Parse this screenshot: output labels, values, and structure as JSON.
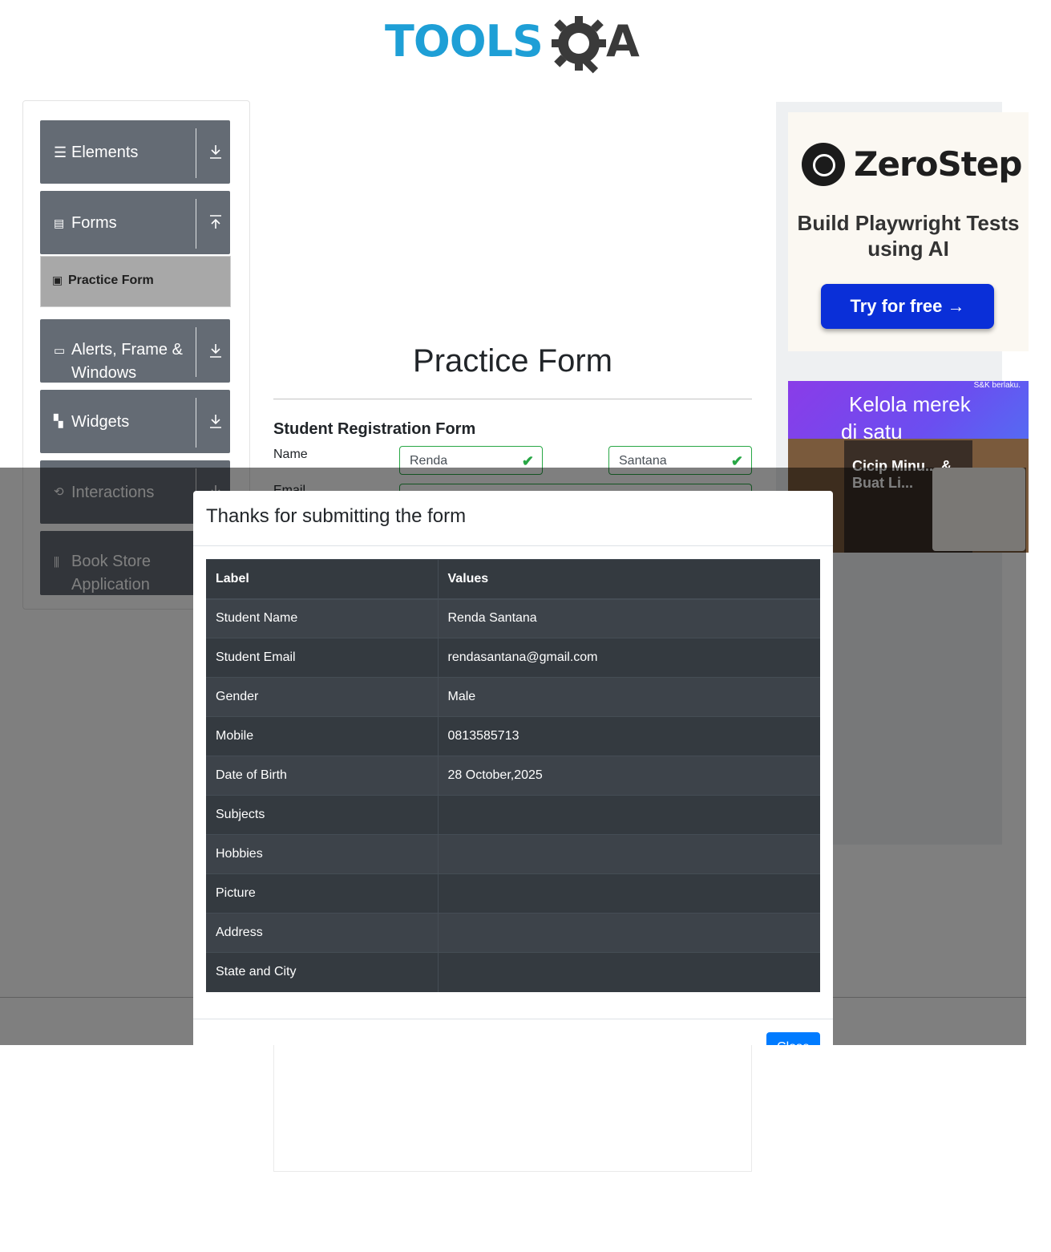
{
  "header": {
    "logo_word": "TOOLS",
    "logo_a": "A"
  },
  "sidebar": {
    "groups": [
      {
        "label": "Elements",
        "icon": "list-icon"
      },
      {
        "label": "Forms",
        "icon": "document-icon"
      },
      {
        "label": "Alerts, Frame & Windows",
        "icon": "window-icon"
      },
      {
        "label": "Widgets",
        "icon": "widgets-icon"
      },
      {
        "label": "Interactions",
        "icon": "interactions-icon"
      },
      {
        "label": "Book Store Application",
        "icon": "books-icon"
      }
    ],
    "active_item": "Practice Form"
  },
  "main": {
    "title": "Practice Form",
    "form_heading": "Student Registration Form",
    "name_label": "Name",
    "email_label": "Email",
    "first_name": "Renda",
    "last_name": "Santana"
  },
  "ads": {
    "zerostep_name": "ZeroStep",
    "zerostep_tagline": "Build Playwright Tests using AI",
    "zerostep_cta": "Try for free →",
    "banner_line1": "Kelola merek",
    "banner_line2": "di satu",
    "banner_note": "S&K berlaku.",
    "banner_card": "Cicip Minu... & Buat Li..."
  },
  "modal": {
    "title": "Thanks for submitting the form",
    "columns": [
      "Label",
      "Values"
    ],
    "rows": [
      [
        "Student Name",
        "Renda Santana"
      ],
      [
        "Student Email",
        "rendasantana@gmail.com"
      ],
      [
        "Gender",
        "Male"
      ],
      [
        "Mobile",
        "0813585713"
      ],
      [
        "Date of Birth",
        "28 October,2025"
      ],
      [
        "Subjects",
        ""
      ],
      [
        "Hobbies",
        ""
      ],
      [
        "Picture",
        ""
      ],
      [
        "Address",
        ""
      ],
      [
        "State and City",
        ""
      ]
    ],
    "close_label": "Close"
  },
  "colors": {
    "accent": "#007bff",
    "valid": "#28a745",
    "sidebar_group": "#646b74",
    "table_dark": "#343a40"
  }
}
